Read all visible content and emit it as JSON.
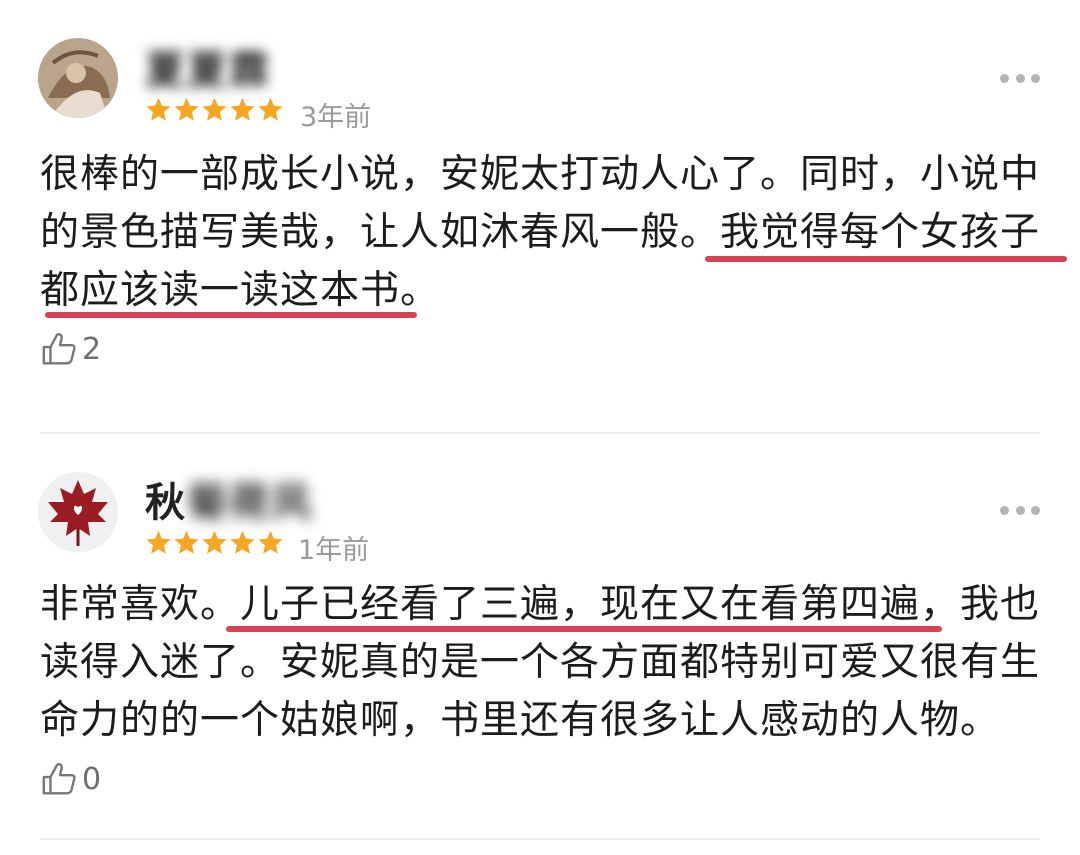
{
  "reviews": [
    {
      "username": "夏夏霖",
      "username_visible_prefix": "",
      "rating": 5,
      "time": "3年前",
      "text_lines": [
        "很棒的一部成长小说，安妮太打动人心了。同时，小说中",
        "的景色描写美哉，让人如沐春风一般。我觉得每个女孩子",
        "都应该读一读这本书。"
      ],
      "highlighted_text": "我觉得每个女孩子都应该读一读这本书。",
      "likes": "2"
    },
    {
      "username": "秋菊荷风",
      "username_visible_prefix": "秋",
      "rating": 5,
      "time": "1年前",
      "text_lines": [
        "非常喜欢。儿子已经看了三遍，现在又在看第四遍，我也",
        "读得入迷了。安妮真的是一个各方面都特别可爱又很有生",
        "命力的的一个姑娘啊，书里还有很多让人感动的人物。"
      ],
      "highlighted_text": "儿子已经看了三遍，现在又在看第四遍，",
      "likes": "0"
    }
  ],
  "colors": {
    "star": "#f5a623",
    "highlight_underline": "#d84355",
    "time_text": "#9a9a9a"
  },
  "icons": {
    "more": "more-dots-icon",
    "like": "thumbs-up-icon",
    "star": "star-icon"
  }
}
